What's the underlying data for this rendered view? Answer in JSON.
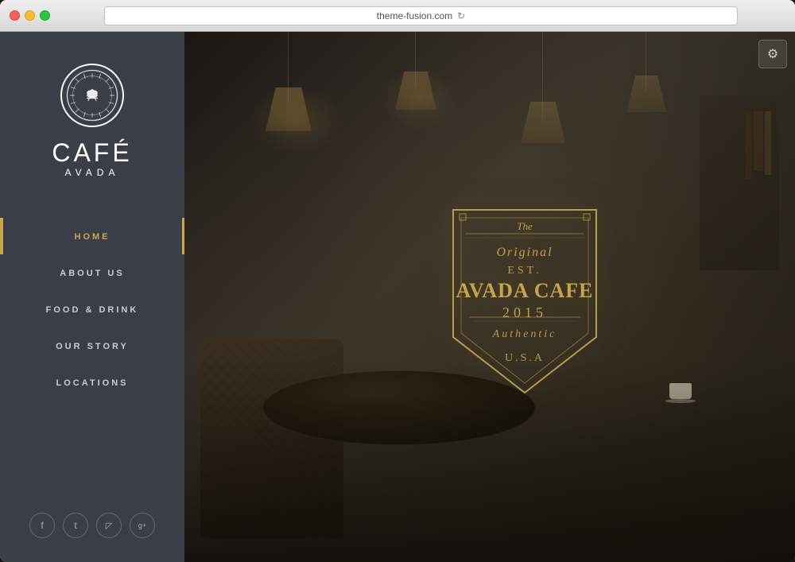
{
  "browser": {
    "url": "theme-fusion.com",
    "traffic_lights": [
      "close",
      "minimize",
      "maximize"
    ]
  },
  "sidebar": {
    "logo_alt": "Cafe Avada Logo",
    "cafe_name": "CAFÉ",
    "cafe_tagline": "AVADA",
    "nav_items": [
      {
        "id": "home",
        "label": "HOME",
        "active": true
      },
      {
        "id": "about",
        "label": "ABOUT US",
        "active": false
      },
      {
        "id": "food",
        "label": "FOOD & DRINK",
        "active": false
      },
      {
        "id": "story",
        "label": "OUR STORY",
        "active": false
      },
      {
        "id": "locations",
        "label": "LOCATIONS",
        "active": false
      }
    ],
    "social": [
      {
        "id": "facebook",
        "icon": "f"
      },
      {
        "id": "twitter",
        "icon": "t"
      },
      {
        "id": "instagram",
        "icon": "i"
      },
      {
        "id": "googleplus",
        "icon": "g+"
      }
    ]
  },
  "hero": {
    "badge": {
      "line1": "The",
      "line2": "Original",
      "line3": "EST.",
      "line4": "AVADA CAFE",
      "line5": "2015",
      "line6": "Authentic",
      "line7": "U.S.A"
    }
  },
  "settings_button_label": "⚙"
}
